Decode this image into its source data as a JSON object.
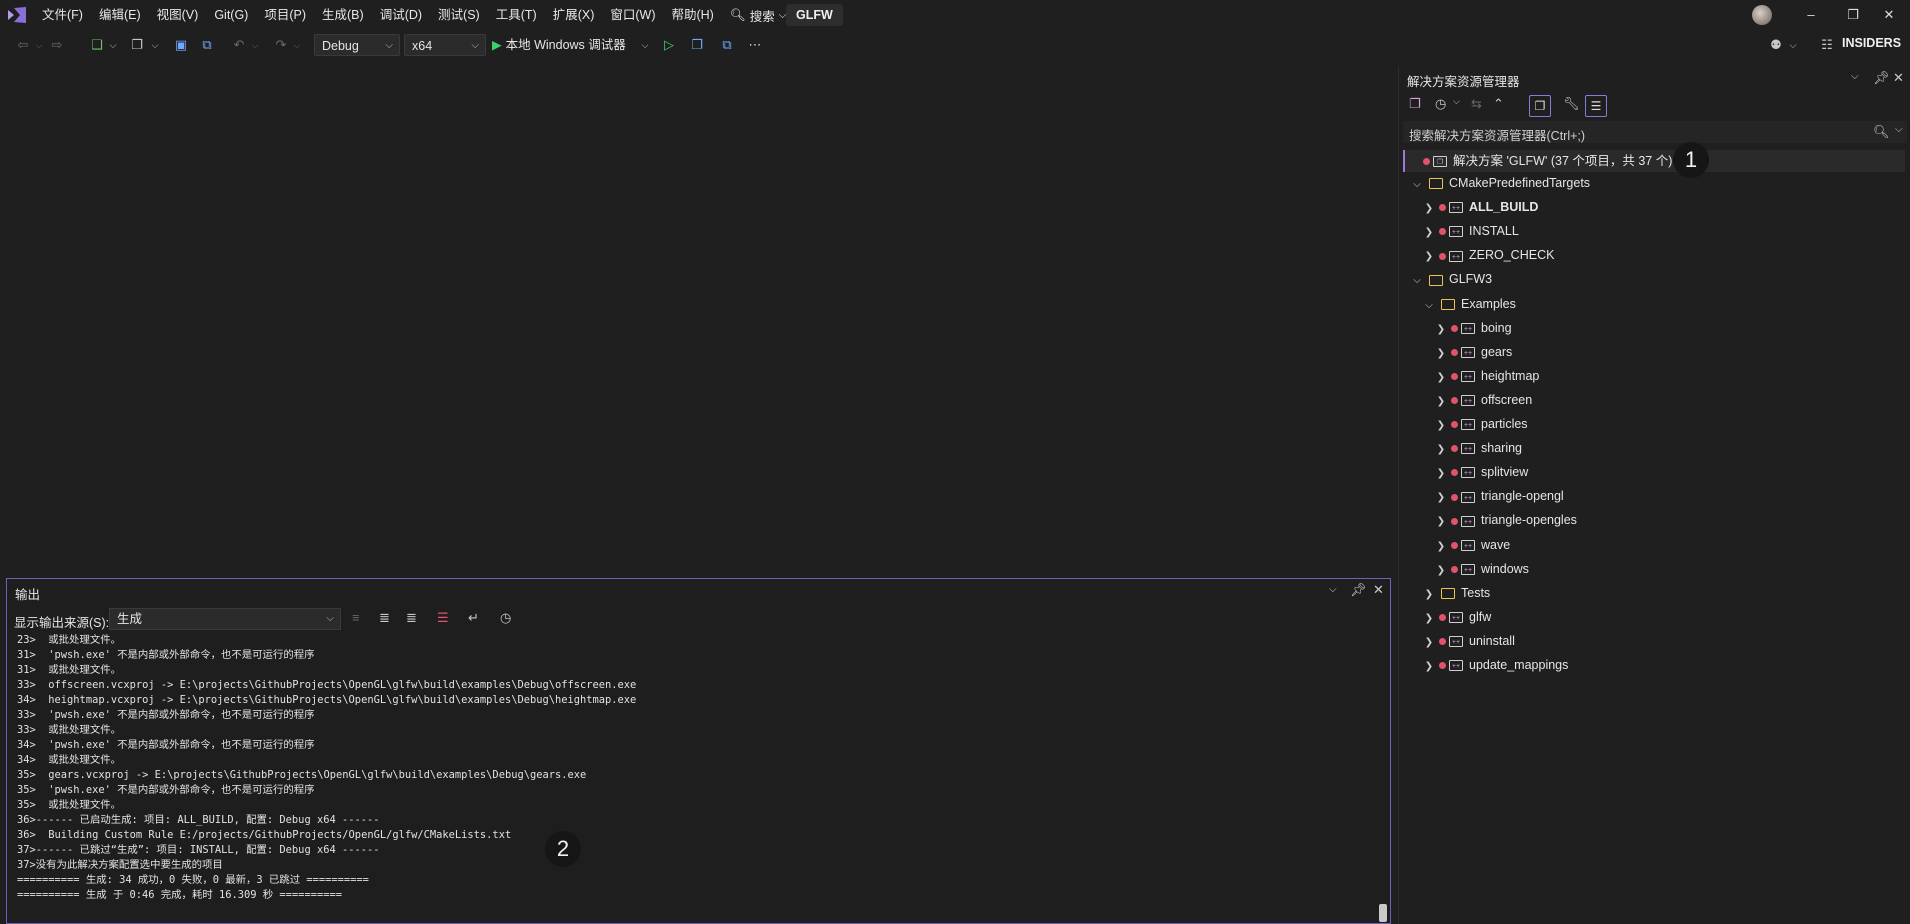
{
  "menubar": {
    "items": [
      "文件(F)",
      "编辑(E)",
      "视图(V)",
      "Git(G)",
      "项目(P)",
      "生成(B)",
      "调试(D)",
      "测试(S)",
      "工具(T)",
      "扩展(X)",
      "窗口(W)",
      "帮助(H)"
    ],
    "search_label": "搜索",
    "solution_name": "GLFW"
  },
  "toolbar": {
    "configuration": "Debug",
    "platform": "x64",
    "run_target": "本地 Windows 调试器",
    "insiders": "INSIDERS"
  },
  "output": {
    "title": "输出",
    "source_label": "显示输出来源(S):",
    "source_value": "生成",
    "lines": [
      "23>  或批处理文件。",
      "31>  'pwsh.exe' 不是内部或外部命令，也不是可运行的程序",
      "31>  或批处理文件。",
      "33>  offscreen.vcxproj -> E:\\projects\\GithubProjects\\OpenGL\\glfw\\build\\examples\\Debug\\offscreen.exe",
      "34>  heightmap.vcxproj -> E:\\projects\\GithubProjects\\OpenGL\\glfw\\build\\examples\\Debug\\heightmap.exe",
      "33>  'pwsh.exe' 不是内部或外部命令，也不是可运行的程序",
      "33>  或批处理文件。",
      "34>  'pwsh.exe' 不是内部或外部命令，也不是可运行的程序",
      "34>  或批处理文件。",
      "35>  gears.vcxproj -> E:\\projects\\GithubProjects\\OpenGL\\glfw\\build\\examples\\Debug\\gears.exe",
      "35>  'pwsh.exe' 不是内部或外部命令，也不是可运行的程序",
      "35>  或批处理文件。",
      "36>------ 已启动生成: 项目: ALL_BUILD, 配置: Debug x64 ------",
      "36>  Building Custom Rule E:/projects/GithubProjects/OpenGL/glfw/CMakeLists.txt",
      "37>------ 已跳过“生成”: 项目: INSTALL, 配置: Debug x64 ------",
      "37>没有为此解决方案配置选中要生成的项目",
      "========== 生成: 34 成功，0 失败，0 最新，3 已跳过 ==========",
      "========== 生成 于 0:46 完成，耗时 16.309 秒 =========="
    ],
    "callout": "2"
  },
  "solution_explorer": {
    "title": "解决方案资源管理器",
    "search_placeholder": "搜索解决方案资源管理器(Ctrl+;)",
    "solution_label": "解决方案 'GLFW' (37 个项目，共 37 个)",
    "callout": "1",
    "tree": [
      {
        "label": "CMakePredefinedTargets",
        "kind": "folder",
        "level": 1,
        "expanded": true,
        "bold": false
      },
      {
        "label": "ALL_BUILD",
        "kind": "project",
        "level": 2,
        "expanded": false,
        "bold": true
      },
      {
        "label": "INSTALL",
        "kind": "project",
        "level": 2,
        "expanded": false,
        "bold": false
      },
      {
        "label": "ZERO_CHECK",
        "kind": "project",
        "level": 2,
        "expanded": false,
        "bold": false
      },
      {
        "label": "GLFW3",
        "kind": "folder",
        "level": 1,
        "expanded": true,
        "bold": false
      },
      {
        "label": "Examples",
        "kind": "folder",
        "level": 2,
        "expanded": true,
        "bold": false
      },
      {
        "label": "boing",
        "kind": "project",
        "level": 3,
        "expanded": false,
        "bold": false
      },
      {
        "label": "gears",
        "kind": "project",
        "level": 3,
        "expanded": false,
        "bold": false
      },
      {
        "label": "heightmap",
        "kind": "project",
        "level": 3,
        "expanded": false,
        "bold": false
      },
      {
        "label": "offscreen",
        "kind": "project",
        "level": 3,
        "expanded": false,
        "bold": false
      },
      {
        "label": "particles",
        "kind": "project",
        "level": 3,
        "expanded": false,
        "bold": false
      },
      {
        "label": "sharing",
        "kind": "project",
        "level": 3,
        "expanded": false,
        "bold": false
      },
      {
        "label": "splitview",
        "kind": "project",
        "level": 3,
        "expanded": false,
        "bold": false
      },
      {
        "label": "triangle-opengl",
        "kind": "project",
        "level": 3,
        "expanded": false,
        "bold": false
      },
      {
        "label": "triangle-opengles",
        "kind": "project",
        "level": 3,
        "expanded": false,
        "bold": false
      },
      {
        "label": "wave",
        "kind": "project",
        "level": 3,
        "expanded": false,
        "bold": false
      },
      {
        "label": "windows",
        "kind": "project",
        "level": 3,
        "expanded": false,
        "bold": false
      },
      {
        "label": "Tests",
        "kind": "folder",
        "level": 2,
        "expanded": false,
        "bold": false
      },
      {
        "label": "glfw",
        "kind": "project",
        "level": 2,
        "expanded": false,
        "bold": false
      },
      {
        "label": "uninstall",
        "kind": "project",
        "level": 2,
        "expanded": false,
        "bold": false
      },
      {
        "label": "update_mappings",
        "kind": "project",
        "level": 2,
        "expanded": false,
        "bold": false
      }
    ]
  },
  "colors": {
    "background": "#1f1f1f",
    "accent": "#6f5fbf",
    "run_green": "#3fcf6f",
    "error_dot": "#e0536a",
    "folder": "#e7c35a"
  }
}
